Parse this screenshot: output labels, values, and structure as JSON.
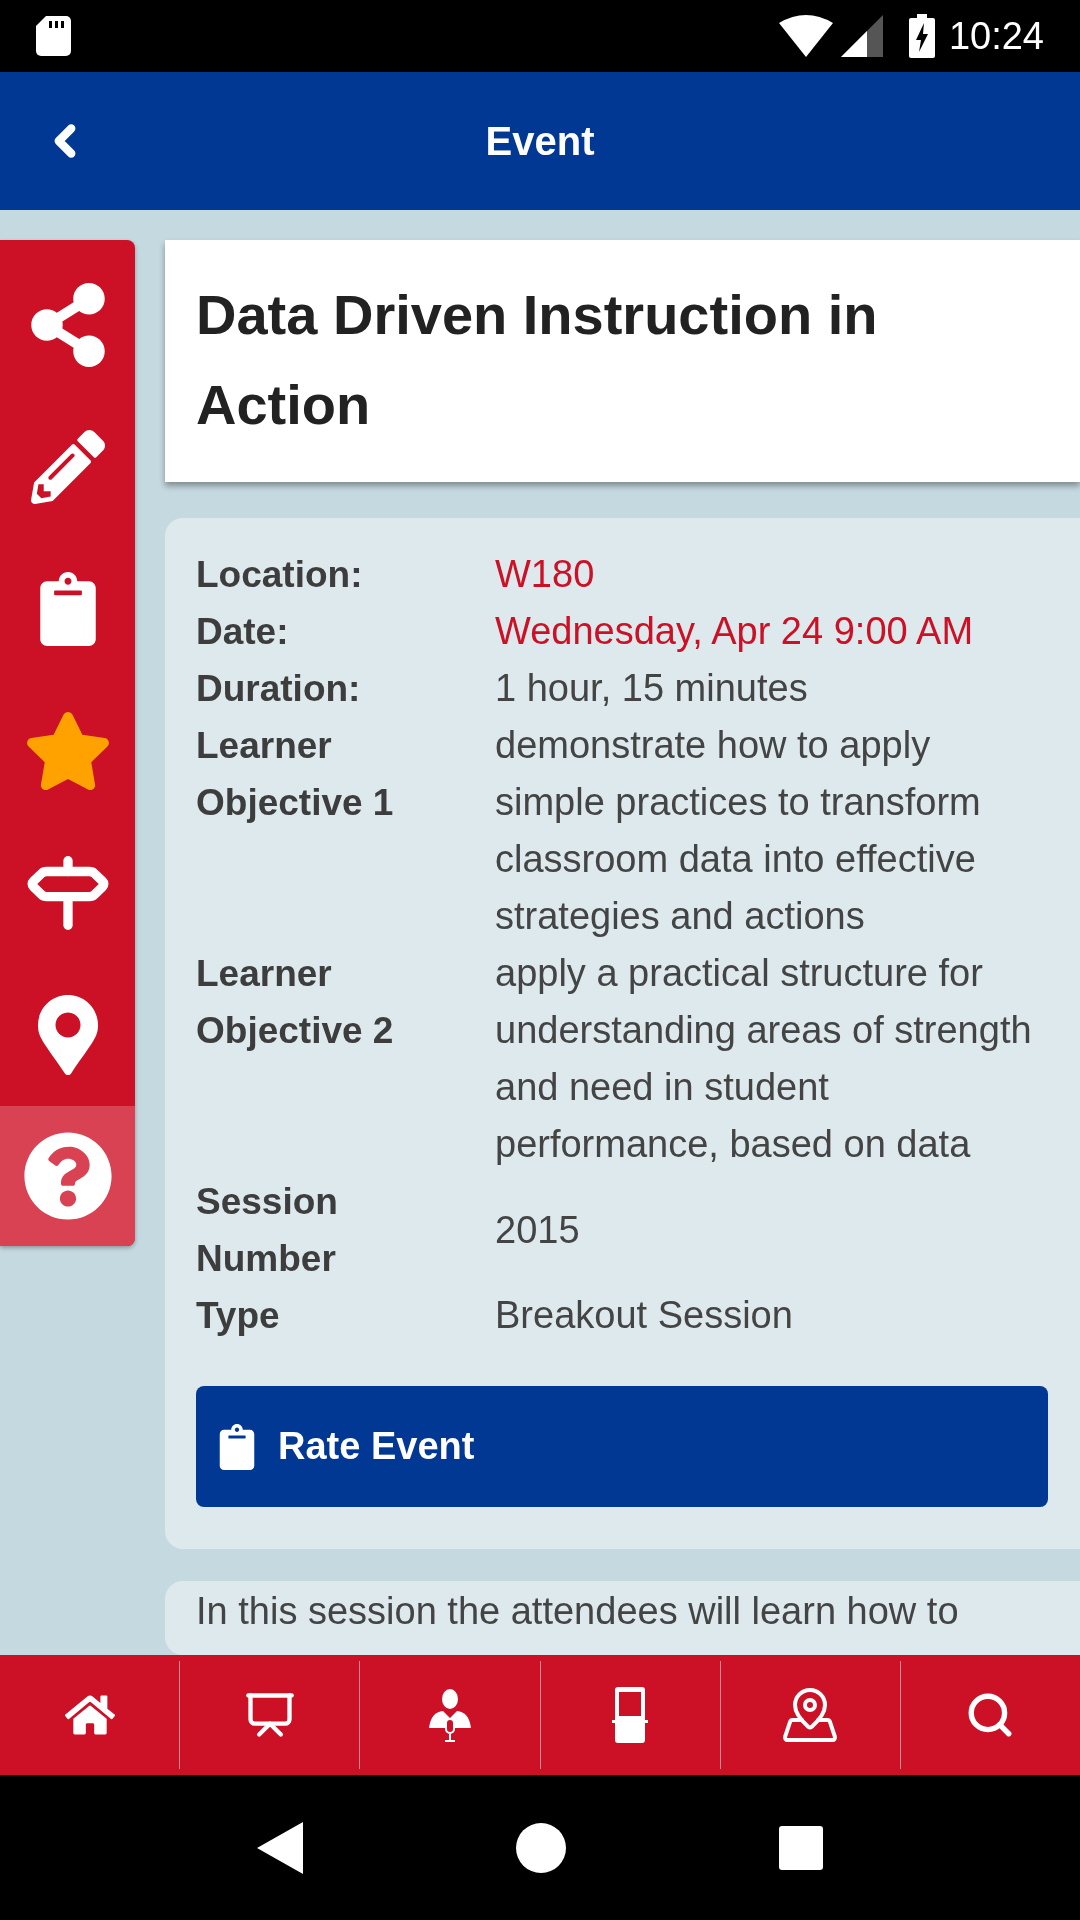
{
  "status_bar": {
    "time": "10:24"
  },
  "header": {
    "title": "Event"
  },
  "event": {
    "title": "Data Driven Instruction in Action",
    "details": [
      {
        "label": "Location:",
        "value": "W180",
        "kind": "link"
      },
      {
        "label": "Date:",
        "value": "Wednesday, Apr 24 9:00 AM",
        "kind": "link"
      },
      {
        "label": "Duration:",
        "value": "1 hour, 15 minutes",
        "kind": "text"
      },
      {
        "label": "Learner Objective 1",
        "value": "demonstrate how to apply simple practices to transform classroom data into effective strategies and actions",
        "kind": "text"
      },
      {
        "label": "Learner Objective 2",
        "value": "apply a practical structure for understanding areas of strength and need in student performance, based on data",
        "kind": "text"
      },
      {
        "label": "Session Number",
        "value": "2015",
        "kind": "text"
      },
      {
        "label": "Type",
        "value": "Breakout Session",
        "kind": "text"
      }
    ],
    "rate_button": "Rate Event",
    "description": "In this session the attendees will learn how to"
  }
}
